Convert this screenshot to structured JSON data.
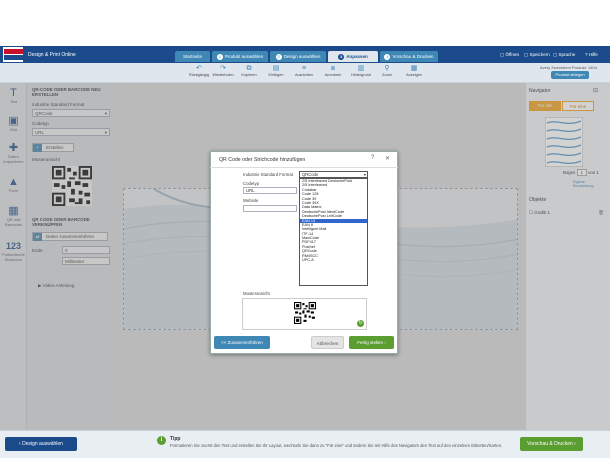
{
  "header": {
    "product_title": "Design & Print Online",
    "steps": [
      {
        "num": "",
        "label": "Startseite"
      },
      {
        "num": "1",
        "label": "Produkt auswählen"
      },
      {
        "num": "2",
        "label": "Design auswählen"
      },
      {
        "num": "3",
        "label": "Anpassen"
      },
      {
        "num": "4",
        "label": "Vorschau & Drucken"
      }
    ],
    "links": {
      "open": "Öffnen",
      "save": "Speichern",
      "language": "Sprache",
      "help": "Hilfe"
    }
  },
  "toolbar": {
    "tools": [
      "Rückgängig",
      "Wiederholen",
      "Kopieren",
      "Einfügen",
      "Ausrichten",
      "Anordnen",
      "Hintergrund",
      "Zoom",
      "Anzeigen"
    ],
    "article_no": "Avery Zweckform Produkt: 1404",
    "add_product": "Produkt ablegen"
  },
  "left_rail": [
    {
      "icon": "T",
      "label": "Text"
    },
    {
      "icon": "▣",
      "label": "Bild"
    },
    {
      "icon": "✚",
      "label": "Daten importieren"
    },
    {
      "icon": "▲",
      "label": "Form"
    },
    {
      "icon": "▦",
      "label": "QR und Barcodes"
    },
    {
      "icon": "123",
      "label": "Fortlaufende Nummern"
    }
  ],
  "left_panel": {
    "section1_title": "QR-CODE ODER BARCODE NEU ERSTELLEN",
    "format_label": "Industrie Standard Format",
    "format_value": "QRCode",
    "codetype_label": "Codetyp",
    "codetype_value": "URL",
    "create_button": "Erstellen",
    "preview_label": "Musteransicht",
    "section2_title": "QR CODE ODER BARCODE VERKNÜPFEN",
    "merge_button": "Daten zusammenführen",
    "ende_label": "Ende",
    "ende_value": "0",
    "unit_value": "Millimeter",
    "video_link": "Video-Anleitung"
  },
  "right_panel": {
    "navigator_title": "Navigator",
    "for_all": "Für alle",
    "for_one": "Für eine",
    "sheet_label": "Bogen",
    "sheet_value": "1",
    "sheet_total": "von 1",
    "sheet_btn": "Eigene Bearbeitung",
    "objects_title": "Objekte",
    "object_item": "Grafik 1"
  },
  "modal": {
    "title": "QR Code oder Strichcode hinzufügen",
    "format_label": "Industrie Standard Format",
    "format_value": "QRCode",
    "codetype_label": "Codetyp",
    "codetype_value": "URL",
    "website_label": "Website",
    "options": [
      "2/5 Interleaved DeutschePost",
      "2/5 Interleaved",
      "Codabar",
      "Code 128",
      "Code 39",
      "Code 39X",
      "Data Matrix",
      "DeutschePost IdentCode",
      "DeutschePost LeitCode",
      "EAN 13",
      "EAN 8",
      "Intelligent Mail",
      "ITF-14",
      "MaxiCode",
      "PDF417",
      "Postnet",
      "QRCode",
      "RM4SCC",
      "UPC-A"
    ],
    "selected_index": 9,
    "preview_label": "Musteransicht",
    "merge_button": "<< Zusammenführen",
    "cancel_button": "Abbrechen",
    "done_button": "Fertig stellen"
  },
  "bottom": {
    "back_button": "Design auswählen",
    "tip_title": "Tipp",
    "tip_text": "Formatieren Sie zuerst den Text und erstellen Sie Ihr Layout, wechseln Sie dann zu \"Für eine\" und ändern Sie mit Hilfe des Navigators den Text auf den einzelnen Etiketten/Karten.",
    "next_button": "Vorschau & Drucken"
  },
  "colors": {
    "brand": "#1b4b8a",
    "accent": "#3f88b5",
    "orange": "#f0a31f",
    "green": "#5a9e32"
  }
}
